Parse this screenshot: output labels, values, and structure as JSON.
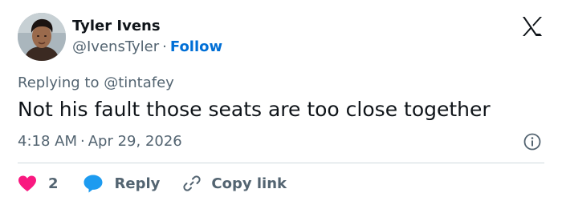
{
  "author": {
    "name": "Tyler Ivens",
    "handle": "@IvensTyler",
    "separator": "·",
    "follow_label": "Follow",
    "avatar_icon": "profile-photo"
  },
  "brand": {
    "logo": "x-logo-icon"
  },
  "tweet": {
    "reply_prefix": "Replying to",
    "reply_to": "@tintafey",
    "text": "Not his fault those seats are too close together",
    "time": "4:18 AM",
    "separator": "·",
    "date": "Apr 29, 2026"
  },
  "actions": {
    "like_count": "2",
    "reply_label": "Reply",
    "copy_label": "Copy link"
  },
  "colors": {
    "text": "#0f1419",
    "secondary": "#536471",
    "link": "#006fd6",
    "like": "#f91880",
    "reply_icon": "#1d9bf0",
    "divider": "#cfd9de"
  }
}
